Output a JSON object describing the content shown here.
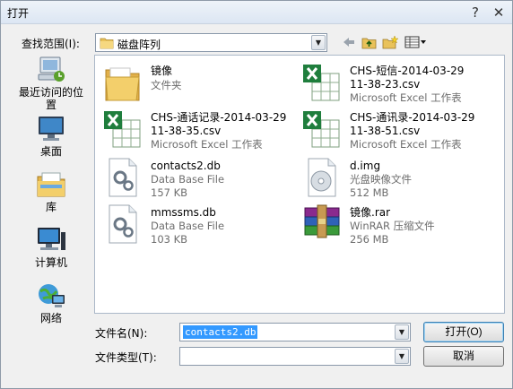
{
  "window": {
    "title": "打开",
    "close_glyph": "✕"
  },
  "toolbar": {
    "look_in_label": "查找范围(I):",
    "look_in_value": "磁盘阵列",
    "icons": [
      "back-icon",
      "up-folder-icon",
      "new-folder-icon",
      "view-menu-icon"
    ]
  },
  "places": [
    {
      "label": "最近访问的位置",
      "icon": "recent-places-icon"
    },
    {
      "label": "桌面",
      "icon": "desktop-icon"
    },
    {
      "label": "库",
      "icon": "libraries-icon"
    },
    {
      "label": "计算机",
      "icon": "computer-icon"
    },
    {
      "label": "网络",
      "icon": "network-icon"
    }
  ],
  "files": [
    {
      "name": "镜像",
      "type": "文件夹",
      "icon": "folder-icon"
    },
    {
      "name": "CHS-短信-2014-03-29",
      "name2": "11-38-23.csv",
      "type": "Microsoft Excel 工作表",
      "icon": "excel-icon"
    },
    {
      "name": "CHS-通话记录-2014-03-29",
      "name2": "11-38-35.csv",
      "type": "Microsoft Excel 工作表",
      "icon": "excel-icon"
    },
    {
      "name": "CHS-通讯录-2014-03-29",
      "name2": "11-38-51.csv",
      "type": "Microsoft Excel 工作表",
      "icon": "excel-icon"
    },
    {
      "name": "contacts2.db",
      "type": "Data Base File",
      "size": "157 KB",
      "icon": "database-file-icon"
    },
    {
      "name": "d.img",
      "type": "光盘映像文件",
      "size": "512 MB",
      "icon": "disc-image-icon"
    },
    {
      "name": "mmssms.db",
      "type": "Data Base File",
      "size": "103 KB",
      "icon": "database-file-icon"
    },
    {
      "name": "镜像.rar",
      "type": "WinRAR 压缩文件",
      "size": "256 MB",
      "icon": "winrar-icon"
    }
  ],
  "footer": {
    "filename_label": "文件名(N):",
    "filename_value": "contacts2.db",
    "filetype_label": "文件类型(T):",
    "filetype_value": "",
    "open_button": "打开(O)",
    "cancel_button": "取消"
  }
}
